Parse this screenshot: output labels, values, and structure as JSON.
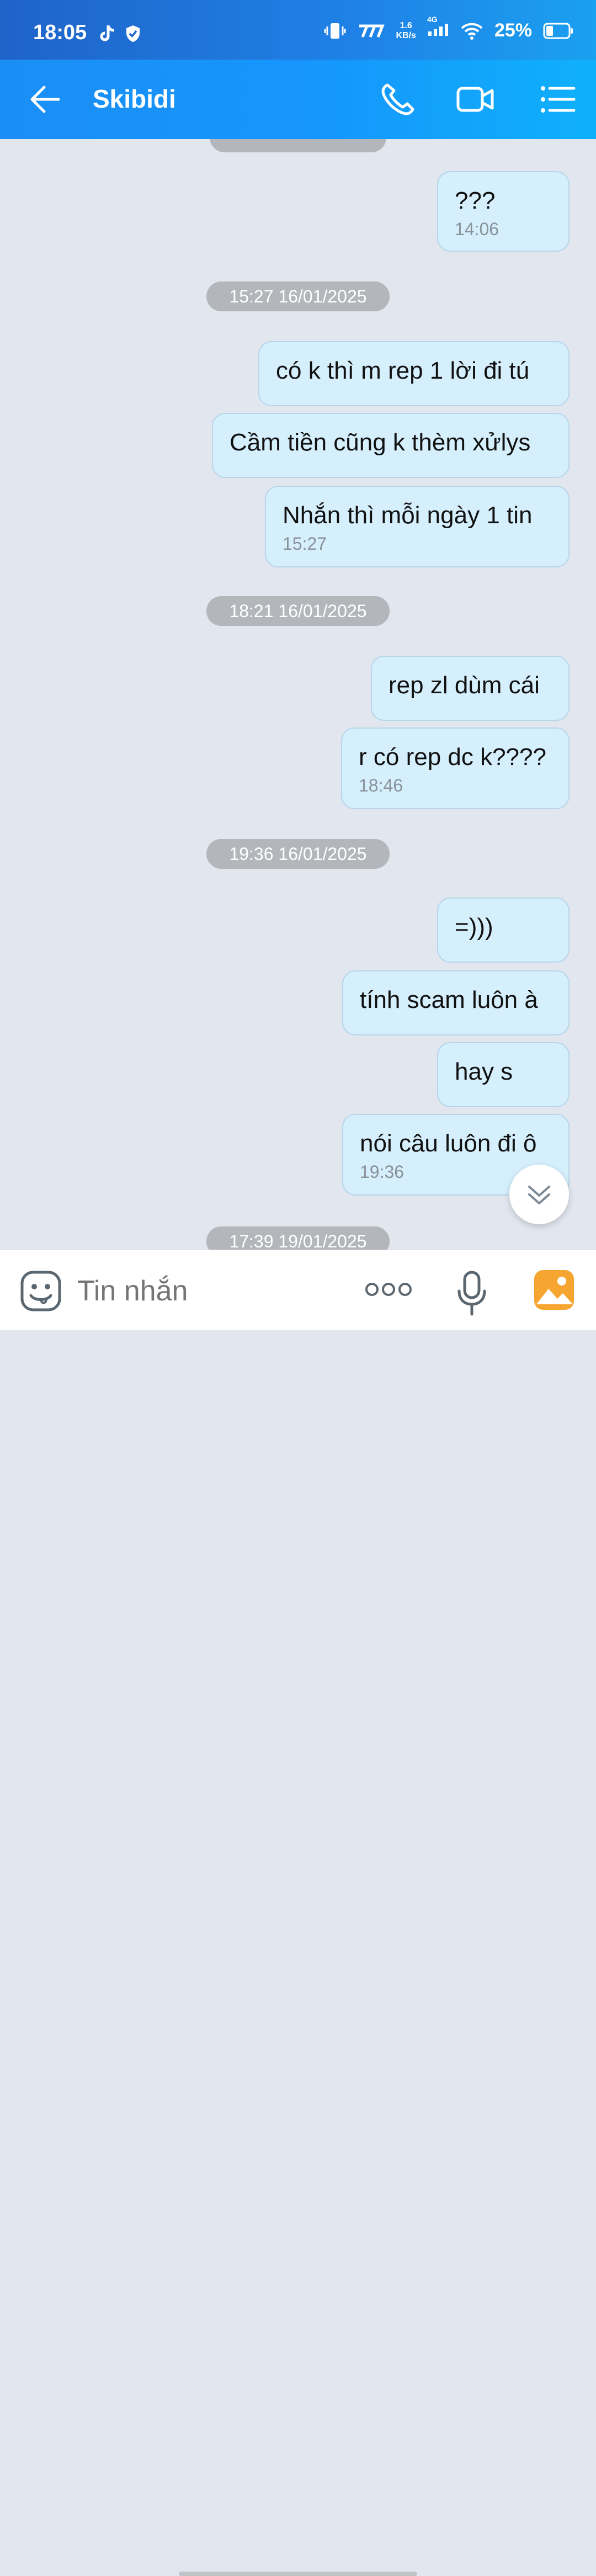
{
  "status_bar": {
    "time": "18:05",
    "net_speed_value": "1.6",
    "net_speed_unit": "KB/s",
    "network": "4G",
    "battery": "25%"
  },
  "header": {
    "title": "Skibidi",
    "icons": [
      "back-arrow-icon",
      "phone-icon",
      "video-icon",
      "menu-list-icon"
    ]
  },
  "messages": [
    {
      "text": "???",
      "time": "14:06"
    },
    {
      "divider": "15:27 16/01/2025"
    },
    {
      "text": "có k thì m rep 1 lời đi tú"
    },
    {
      "text": "Cầm tiền cũng k thèm xửlys"
    },
    {
      "text": "Nhắn thì mỗi ngày 1 tin",
      "time": "15:27"
    },
    {
      "divider": "18:21 16/01/2025"
    },
    {
      "text": "rep zl dùm cái"
    },
    {
      "text": "r có rep dc k????",
      "time": "18:46"
    },
    {
      "divider": "19:36 16/01/2025"
    },
    {
      "text": "=)))"
    },
    {
      "text": "tính scam luôn à"
    },
    {
      "text": "hay s"
    },
    {
      "text": "nói câu luôn đi ô",
      "time": "19:36"
    },
    {
      "divider": "17:39 19/01/2025"
    }
  ],
  "composer": {
    "placeholder": "Tin nhắn"
  },
  "colors": {
    "header_start": "#1b8ef5",
    "header_end": "#0fb0fb",
    "bubble": "#d5effd",
    "chat_bg": "#e2e7ef",
    "image_button": "#f7a531"
  }
}
